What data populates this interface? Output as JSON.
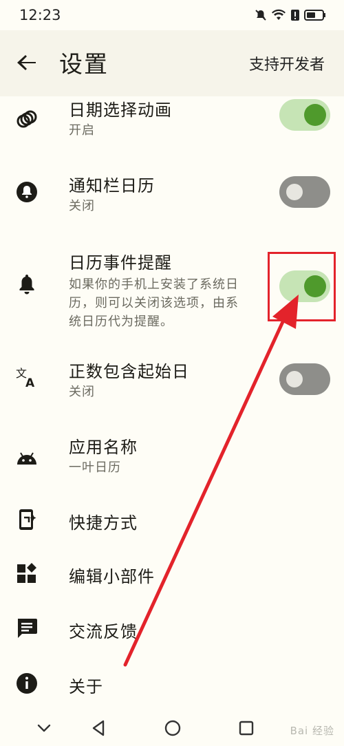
{
  "status": {
    "time": "12:23"
  },
  "header": {
    "title": "设置",
    "action": "支持开发者"
  },
  "settings": [
    {
      "label": "日期选择动画",
      "sub": "开启",
      "toggle": true,
      "icon": "rings-icon"
    },
    {
      "label": "通知栏日历",
      "sub": "关闭",
      "toggle": false,
      "icon": "notification-bell-icon"
    },
    {
      "label": "日历事件提醒",
      "sub_lines": [
        "如果你的手机上安装了系统日",
        "历，则可以关闭该选项，由系",
        "统日历代为提醒。"
      ],
      "toggle": true,
      "icon": "bell-icon"
    },
    {
      "label": "正数包含起始日",
      "sub": "关闭",
      "toggle": false,
      "icon": "translate-icon"
    },
    {
      "label": "应用名称",
      "sub": "一叶日历",
      "icon": "android-icon"
    },
    {
      "label": "快捷方式",
      "icon": "shortcut-icon"
    },
    {
      "label": "编辑小部件",
      "icon": "widgets-icon"
    },
    {
      "label": "交流反馈",
      "icon": "feedback-icon"
    },
    {
      "label": "关于",
      "icon": "info-icon"
    }
  ],
  "watermark": "Bai 经验",
  "colors": {
    "toggle_on_track": "#c6e4b5",
    "toggle_on_knob": "#4f9a2c",
    "toggle_off_track": "#8e8e8a",
    "annotation_red": "#e3232b"
  }
}
